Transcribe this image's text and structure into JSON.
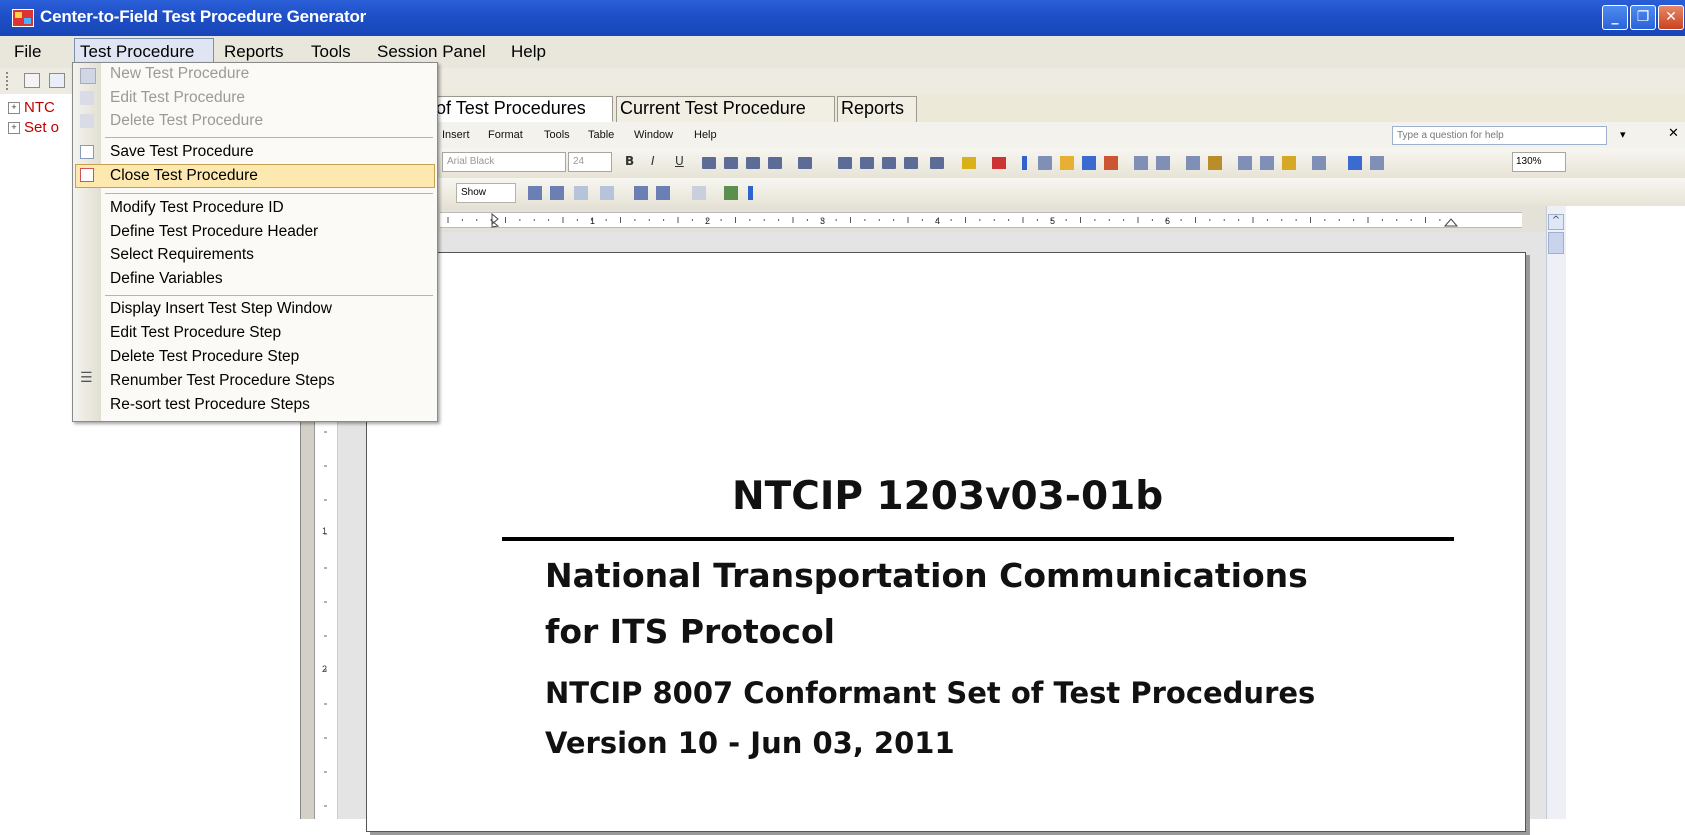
{
  "window": {
    "title": "Center-to-Field Test Procedure Generator"
  },
  "menubar": {
    "items": [
      "File",
      "Test Procedure",
      "Reports",
      "Tools",
      "Session Panel",
      "Help"
    ]
  },
  "tree": {
    "items": [
      "NTC",
      "Set o"
    ]
  },
  "tabs": [
    "of Test Procedures",
    "Current Test Procedure",
    "Reports"
  ],
  "dropdown": {
    "items": [
      {
        "label": "New Test Procedure",
        "enabled": false
      },
      {
        "label": "Edit Test Procedure",
        "enabled": false
      },
      {
        "label": "Delete Test Procedure",
        "enabled": false
      },
      {
        "label": "Save Test Procedure",
        "enabled": true
      },
      {
        "label": "Close Test Procedure",
        "enabled": true,
        "highlighted": true
      },
      {
        "label": "Modify Test Procedure ID",
        "enabled": true
      },
      {
        "label": "Define Test Procedure Header",
        "enabled": true
      },
      {
        "label": "Select Requirements",
        "enabled": true
      },
      {
        "label": "Define Variables",
        "enabled": true
      },
      {
        "label": "Display Insert Test Step Window",
        "enabled": true
      },
      {
        "label": "Edit Test Procedure Step",
        "enabled": true
      },
      {
        "label": "Delete Test Procedure Step",
        "enabled": true
      },
      {
        "label": "Renumber Test Procedure Steps",
        "enabled": true
      },
      {
        "label": "Re-sort test Procedure Steps",
        "enabled": true
      }
    ]
  },
  "word": {
    "menu": [
      "Insert",
      "Format",
      "Tools",
      "Table",
      "Window",
      "Help"
    ],
    "help_placeholder": "Type a question for help",
    "font": "Arial Black",
    "size": "24",
    "zoom": "130%",
    "show": "Show"
  },
  "ruler": {
    "numbers": [
      "1",
      "2",
      "3",
      "4",
      "5",
      "6"
    ]
  },
  "vruler": {
    "numbers": [
      "1",
      "2"
    ]
  },
  "document": {
    "title": "NTCIP 1203v03-01b",
    "org_line1": "National Transportation Communications",
    "org_line2": "for ITS Protocol",
    "set": "NTCIP 8007 Conformant Set of Test Procedures",
    "version": "Version 10 - Jun 03, 2011"
  },
  "colors": {
    "title_bar": "#1f4fc6",
    "menu_highlight": "#fde9b0",
    "tree_text": "#c00000"
  }
}
